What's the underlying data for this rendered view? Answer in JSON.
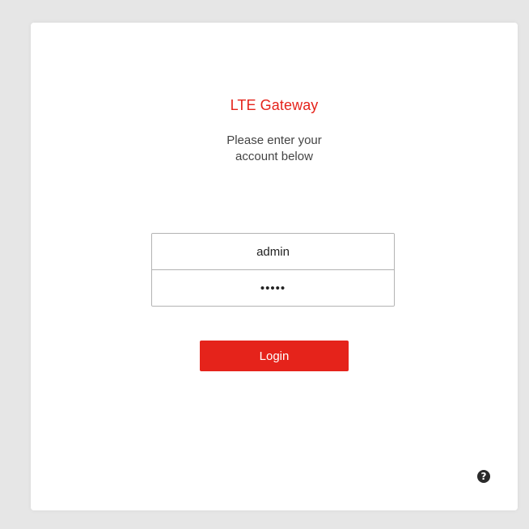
{
  "login": {
    "title": "LTE Gateway",
    "subtitle_line1": "Please enter your",
    "subtitle_line2": "account below",
    "username_value": "admin",
    "password_value": "•••••",
    "login_label": "Login"
  },
  "help": {
    "icon": "help-icon",
    "glyph": "?"
  },
  "colors": {
    "accent": "#e5231b",
    "background": "#e6e6e6",
    "card": "#ffffff"
  }
}
